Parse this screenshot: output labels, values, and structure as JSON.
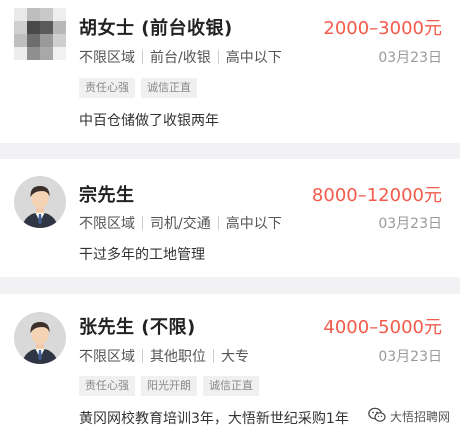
{
  "colors": {
    "salary": "#f25b4b",
    "background": "#f2f2f4",
    "card": "#ffffff"
  },
  "candidates": [
    {
      "avatar_icon": "pixelated-photo-avatar",
      "name": "胡女士 (前台收银)",
      "salary": "2000–3000元",
      "area": "不限区域",
      "position": "前台/收银",
      "education": "高中以下",
      "date": "03月23日",
      "tags": [
        "责任心强",
        "诚信正直"
      ],
      "description": "中百仓储做了收银两年"
    },
    {
      "avatar_icon": "male-avatar-icon",
      "name": "宗先生",
      "salary": "8000–12000元",
      "area": "不限区域",
      "position": "司机/交通",
      "education": "高中以下",
      "date": "03月23日",
      "tags": [],
      "description": "干过多年的工地管理"
    },
    {
      "avatar_icon": "male-avatar-icon",
      "name": "张先生 (不限)",
      "salary": "4000–5000元",
      "area": "不限区域",
      "position": "其他职位",
      "education": "大专",
      "date": "03月23日",
      "tags": [
        "责任心强",
        "阳光开朗",
        "诚信正直"
      ],
      "description": "黄冈网校教育培训3年，大悟新世纪采购1年"
    }
  ],
  "watermark": {
    "icon": "wechat-icon",
    "text": "大悟招聘网"
  }
}
